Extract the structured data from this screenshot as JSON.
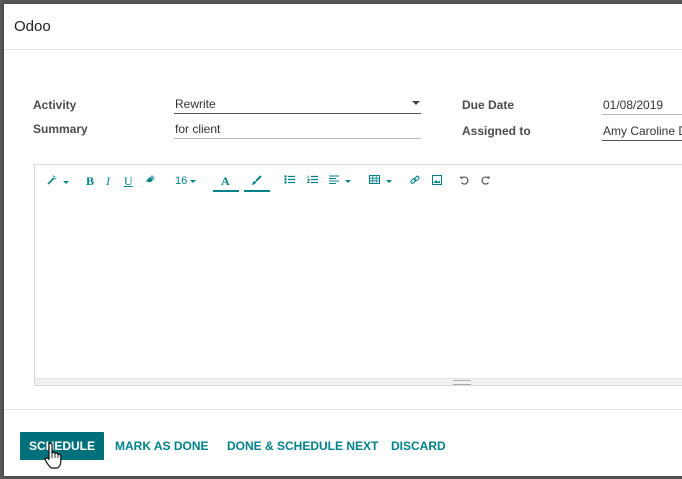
{
  "dialog": {
    "title": "Odoo"
  },
  "form": {
    "activity_label": "Activity",
    "activity_value": "Rewrite",
    "summary_label": "Summary",
    "summary_value": "for client",
    "due_date_label": "Due Date",
    "due_date_value": "01/08/2019",
    "assigned_label": "Assigned to",
    "assigned_value": "Amy Caroline D"
  },
  "toolbar": {
    "bold": "B",
    "italic": "I",
    "underline": "U",
    "font_size": "16",
    "font_color": "A"
  },
  "footer": {
    "schedule": "SCHEDULE",
    "mark_done": "MARK AS DONE",
    "done_schedule_next": "DONE & SCHEDULE NEXT",
    "discard": "DISCARD"
  },
  "colors": {
    "accent": "#00828a",
    "primary_button": "#00717a"
  }
}
